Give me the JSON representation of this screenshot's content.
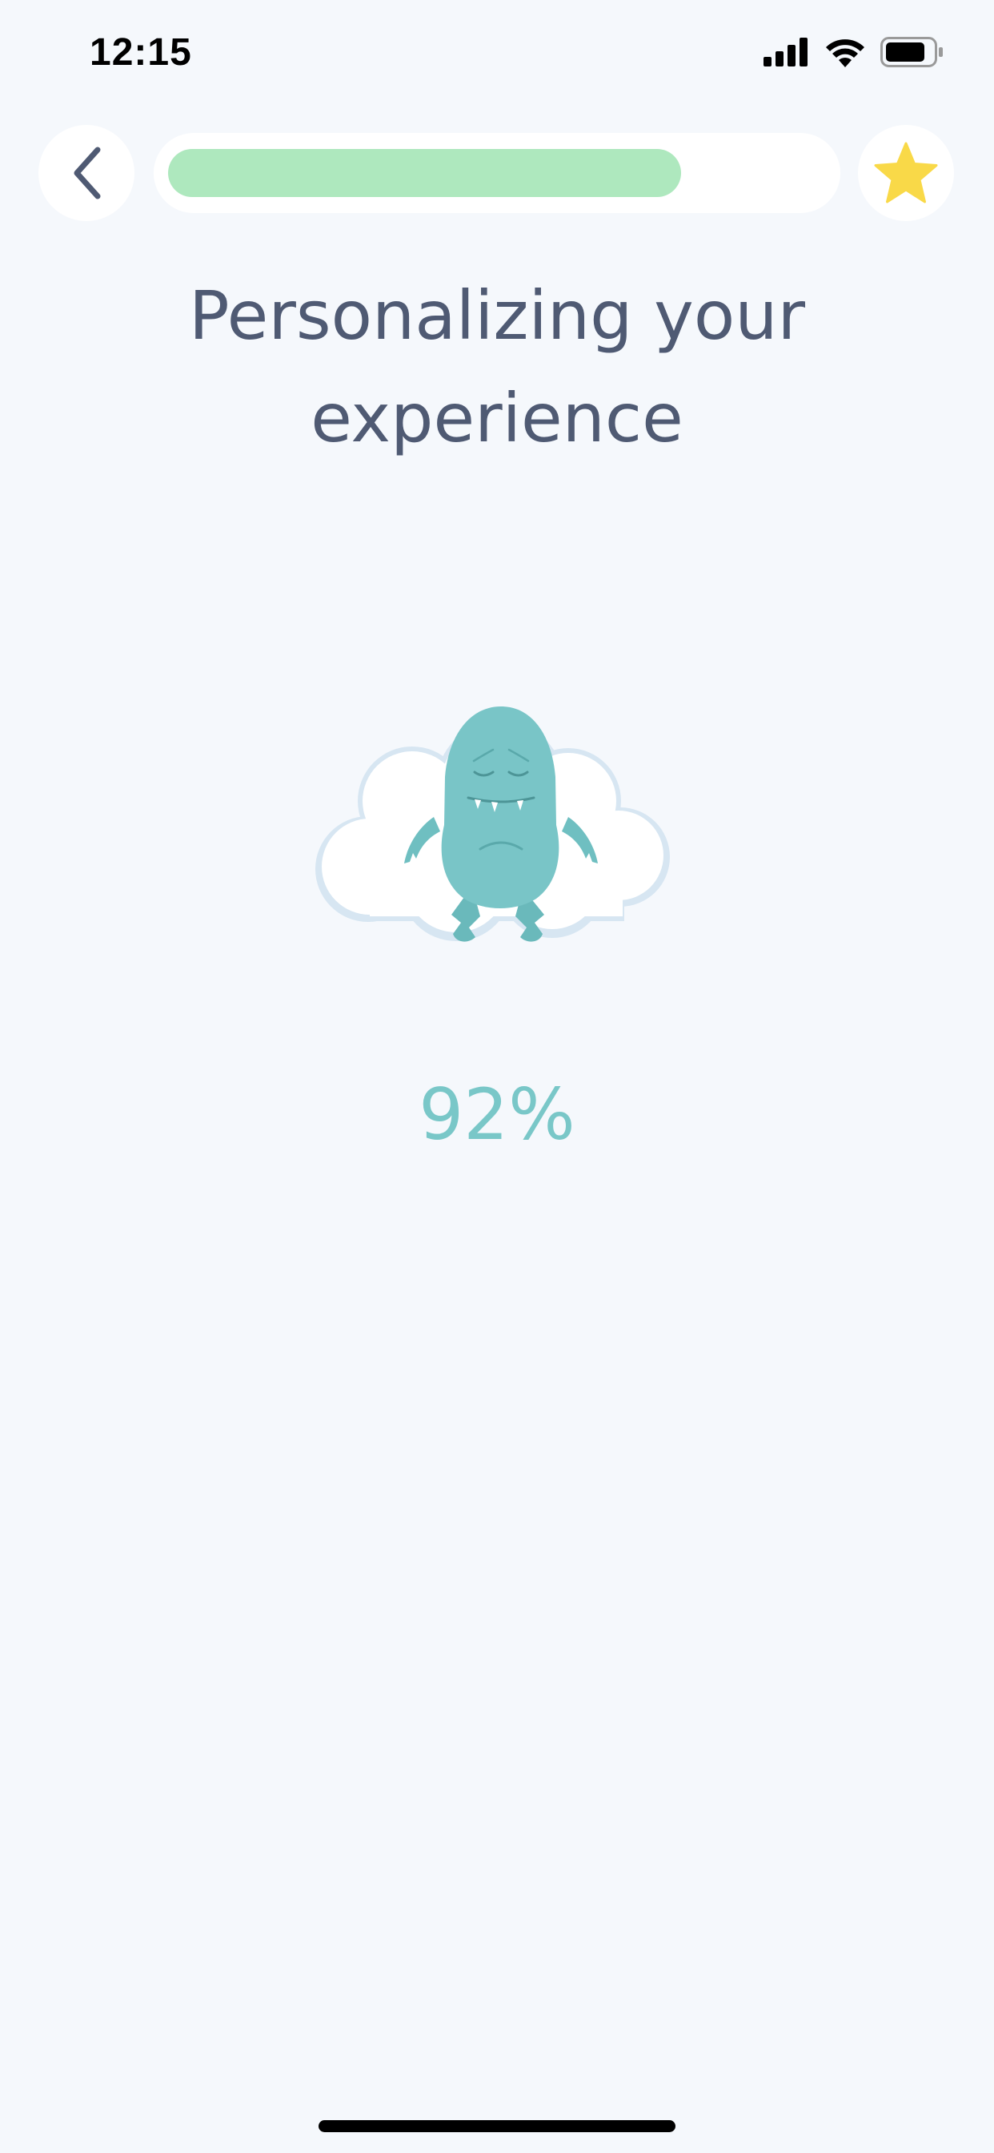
{
  "status_bar": {
    "time": "12:15",
    "icons": [
      "signal-icon",
      "wifi-icon",
      "battery-icon"
    ]
  },
  "top_bar": {
    "back_icon": "chevron-left-icon",
    "progress": 0.78,
    "progress_color": "#aee8be",
    "star_icon": "star-icon",
    "star_color": "#f9d948"
  },
  "content": {
    "title": "Personalizing your experience",
    "illustration": "monster-on-cloud",
    "percent": "92%",
    "percent_color": "#79c7c8"
  },
  "colors": {
    "background": "#f5f8fc",
    "title": "#4f5a73",
    "monster": "#79c5c7"
  }
}
